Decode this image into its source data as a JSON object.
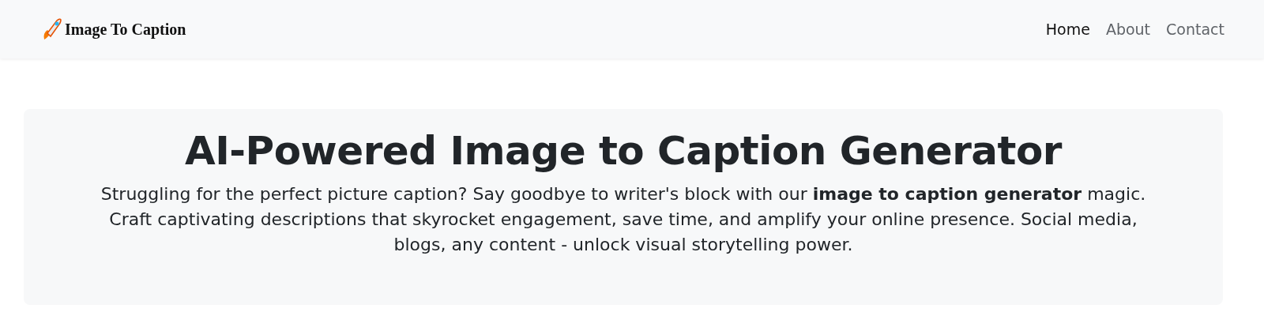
{
  "navbar": {
    "brand": "Image To Caption",
    "links": [
      {
        "label": "Home",
        "selected": true
      },
      {
        "label": "About",
        "selected": false
      },
      {
        "label": "Contact",
        "selected": false
      }
    ]
  },
  "hero": {
    "title": "AI-Powered Image to Caption Generator",
    "text": "Struggling for the perfect picture caption? Say goodbye to writer's block with our **image to caption generator** magic. Craft captivating descriptions that skyrocket engagement, save time, and amplify your online presence. Social media, blogs, any content - unlock visual storytelling power."
  }
}
